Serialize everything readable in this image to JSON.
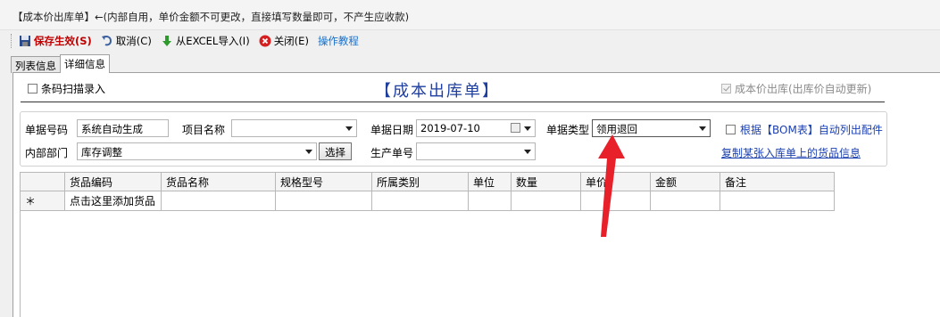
{
  "window": {
    "title": "【成本价出库单】←(内部自用，单价金额不可更改，直接填写数量即可，不产生应收款)"
  },
  "toolbar": {
    "save_label": "保存生效(S)",
    "cancel_label": "取消(C)",
    "import_label": "从EXCEL导入(I)",
    "close_label": "关闭(E)",
    "tutorial_label": "操作教程"
  },
  "tabs": [
    {
      "label": "列表信息"
    },
    {
      "label": "详细信息"
    }
  ],
  "form": {
    "barcode_label": "条码扫描录入",
    "title": "【成本出库单】",
    "cost_out_label": "成本价出库(出库价自动更新)",
    "doc_no_label": "单据号码",
    "doc_no_value": "系统自动生成",
    "project_label": "项目名称",
    "project_value": "",
    "doc_date_label": "单据日期",
    "doc_date_value": "2019-07-10",
    "doc_type_label": "单据类型",
    "doc_type_value": "领用退回",
    "bom_label": "根据【BOM表】自动列出配件",
    "dept_label": "内部部门",
    "dept_value": "库存调整",
    "select_button": "选择",
    "prod_no_label": "生产单号",
    "prod_no_value": "",
    "copy_link": "复制某张入库单上的货品信息"
  },
  "grid": {
    "columns": [
      "货品编码",
      "货品名称",
      "规格型号",
      "所属类别",
      "单位",
      "数量",
      "单价",
      "金额",
      "备注"
    ],
    "new_row_marker": "＊",
    "new_row_hint": "点击这里添加货品"
  },
  "colors": {
    "save": "#c00000",
    "title": "#1f3f9f",
    "link": "#1a3fb0",
    "annotation_arrow": "#e8202a"
  }
}
